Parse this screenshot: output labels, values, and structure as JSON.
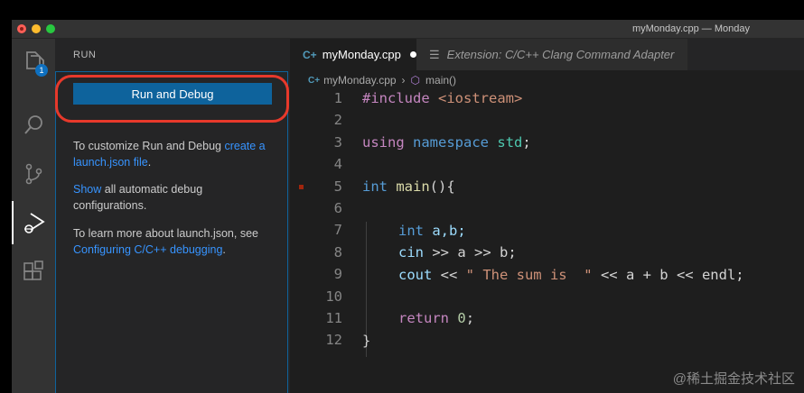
{
  "window": {
    "title": "myMonday.cpp — Monday"
  },
  "activity_bar": {
    "badge": "1",
    "icons": [
      "files-icon",
      "search-icon",
      "source-control-icon",
      "run-debug-icon",
      "extensions-icon"
    ]
  },
  "sidebar": {
    "header": "RUN",
    "run_button": "Run and Debug",
    "help1_a": "To customize Run and Debug ",
    "help1_link1": "create a",
    "help1_link2": "launch.json file",
    "help1_end": ".",
    "help2_link": "Show",
    "help2_rest": " all automatic debug configurations.",
    "help3_a": "To learn more about launch.json, see ",
    "help3_link": "Configuring C/C++ debugging",
    "help3_end": "."
  },
  "tabs": {
    "active": "myMonday.cpp",
    "other": "Extension: C/C++ Clang Command Adapter"
  },
  "breadcrumb": {
    "file": "myMonday.cpp",
    "symbol": "main()"
  },
  "code": {
    "line_numbers": [
      "1",
      "2",
      "3",
      "4",
      "5",
      "6",
      "7",
      "8",
      "9",
      "10",
      "11",
      "12"
    ],
    "l1_kw": "#include",
    "l1_inc": "<iostream>",
    "l3_using": "using",
    "l3_namespace": "namespace",
    "l3_std": "std",
    "l5_int": "int",
    "l5_main": "main",
    "l5_rest": "(){",
    "l7_int": "int",
    "l7_vars": "a,b;",
    "l8_cin": "cin",
    "l8_rest": " >> a >> b;",
    "l9_cout": "cout",
    "l9_op": " << ",
    "l9_str": "\" The sum is  \"",
    "l9_rest": " << a + b << endl;",
    "l11_return": "return",
    "l11_zero": "0",
    "l12_brace": "}"
  },
  "watermark": "@稀土掘金技术社区",
  "colors": {
    "accent": "#0e639c",
    "highlight": "#e8392b"
  }
}
